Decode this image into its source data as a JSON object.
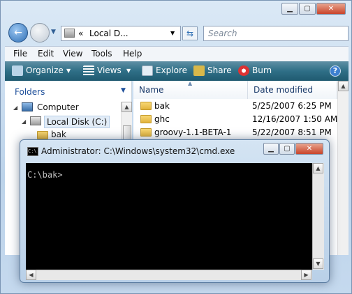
{
  "explorer": {
    "breadcrumb": "Local D...",
    "breadcrumb_prefix": "«",
    "search_placeholder": "Search",
    "menu": [
      "File",
      "Edit",
      "View",
      "Tools",
      "Help"
    ],
    "toolbar": {
      "organize": "Organize",
      "views": "Views",
      "explore": "Explore",
      "share": "Share",
      "burn": "Burn"
    },
    "folders_header": "Folders",
    "tree": {
      "computer": "Computer",
      "local_disk": "Local Disk (C:)",
      "bak": "bak"
    },
    "columns": {
      "name": "Name",
      "date": "Date modified"
    },
    "files": [
      {
        "name": "bak",
        "date": "5/25/2007 6:25 PM"
      },
      {
        "name": "ghc",
        "date": "12/16/2007 1:50 AM"
      },
      {
        "name": "groovy-1.1-BETA-1",
        "date": "5/22/2007 8:51 PM"
      }
    ]
  },
  "cmd": {
    "title": "Administrator: C:\\Windows\\system32\\cmd.exe",
    "prompt": "C:\\bak>"
  },
  "colors": {
    "toolbar": "#2f6f87",
    "console_bg": "#000000",
    "console_fg": "#c0c0c0"
  }
}
